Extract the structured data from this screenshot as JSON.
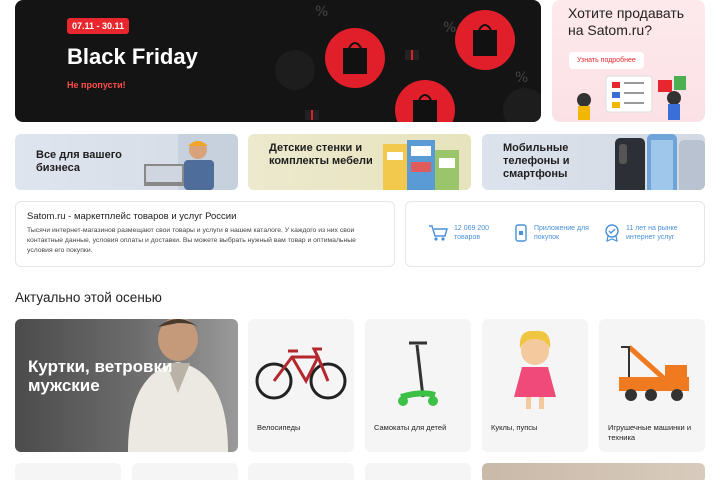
{
  "hero": {
    "date_badge": "07.11 - 30.11",
    "title": "Black Friday",
    "subtitle": "Не пропусти!"
  },
  "promo": {
    "title": "Хотите продавать на Satom.ru?",
    "button": "Узнать подробнее"
  },
  "categories": [
    {
      "label": "Все для вашего бизнеса"
    },
    {
      "label": "Детские стенки и комплекты мебели"
    },
    {
      "label": "Мобильные телефоны и смартфоны"
    }
  ],
  "info": {
    "title": "Satom.ru - маркетплейс товаров и услуг России",
    "text": "Тысячи интернет-магазинов размещают свои товары и услуги в нашем каталоге. У каждого из них свои контактные данные, условия оплаты и доставки. Вы можете выбрать нужный вам товар и оптимальные условия его покупки."
  },
  "stats": [
    {
      "icon": "cart-icon",
      "text": "12 069 200 товаров"
    },
    {
      "icon": "phone-icon",
      "text": "Приложение для покупок"
    },
    {
      "icon": "award-icon",
      "text": "11 лет на рынке интернет услуг"
    }
  ],
  "section": {
    "title": "Актуально этой осенью",
    "featured": "Куртки, ветровки мужские",
    "products": [
      {
        "label": "Велосипеды",
        "icon": "bicycle-icon"
      },
      {
        "label": "Самокаты для детей",
        "icon": "scooter-icon"
      },
      {
        "label": "Куклы, пупсы",
        "icon": "doll-icon"
      },
      {
        "label": "Игрушечные машинки и техника",
        "icon": "toy-crane-icon"
      }
    ]
  },
  "colors": {
    "accent": "#e8262e",
    "link": "#4a90d9"
  }
}
